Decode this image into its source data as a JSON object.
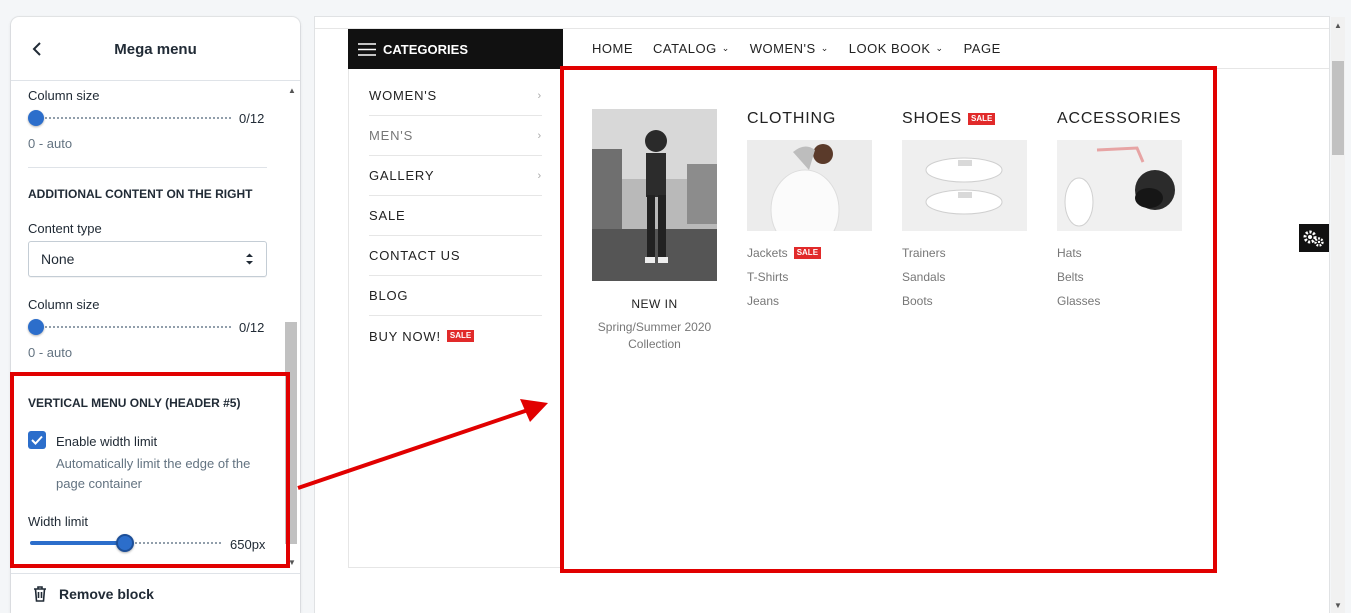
{
  "panel": {
    "title": "Mega menu",
    "column_size_1": {
      "label": "Column size",
      "value": "0/12",
      "help": "0 - auto",
      "fraction": 0
    },
    "section_right": "ADDITIONAL CONTENT ON THE RIGHT",
    "content_type": {
      "label": "Content type",
      "value": "None"
    },
    "column_size_2": {
      "label": "Column size",
      "value": "0/12",
      "help": "0 - auto",
      "fraction": 0
    },
    "section_vertical": "VERTICAL MENU ONLY (HEADER #5)",
    "enable_width": {
      "label": "Enable width limit",
      "checked": true,
      "help": "Automatically limit the edge of the page container"
    },
    "width_limit": {
      "label": "Width limit",
      "value": "650px",
      "fraction": 0.52
    },
    "remove_block": "Remove block"
  },
  "preview": {
    "categories_label": "CATEGORIES",
    "topnav": [
      {
        "label": "HOME",
        "dropdown": false
      },
      {
        "label": "CATALOG",
        "dropdown": true
      },
      {
        "label": "WOMEN'S",
        "dropdown": true
      },
      {
        "label": "LOOK BOOK",
        "dropdown": true
      },
      {
        "label": "PAGE",
        "dropdown": false
      }
    ],
    "vertical_menu": [
      {
        "label": "WOMEN'S",
        "arrow": true
      },
      {
        "label": "MEN'S",
        "arrow": true
      },
      {
        "label": "GALLERY",
        "arrow": true
      },
      {
        "label": "SALE",
        "arrow": false
      },
      {
        "label": "CONTACT US",
        "arrow": false
      },
      {
        "label": "BLOG",
        "arrow": false
      },
      {
        "label": "BUY NOW!",
        "arrow": false,
        "badge": "SALE"
      }
    ],
    "mega": {
      "promo": {
        "title": "NEW IN",
        "subtitle": "Spring/Summer 2020 Collection"
      },
      "columns": [
        {
          "title": "CLOTHING",
          "badge": "",
          "links": [
            "Jackets",
            "T-Shirts",
            "Jeans"
          ],
          "link_badge": "SALE"
        },
        {
          "title": "SHOES",
          "badge": "SALE",
          "links": [
            "Trainers",
            "Sandals",
            "Boots"
          ]
        },
        {
          "title": "ACCESSORIES",
          "badge": "",
          "links": [
            "Hats",
            "Belts",
            "Glasses"
          ]
        }
      ]
    }
  },
  "colors": {
    "accent": "#2c6ecb",
    "annotation": "#e10000",
    "sale": "#e12a2a",
    "dark": "#111111"
  }
}
